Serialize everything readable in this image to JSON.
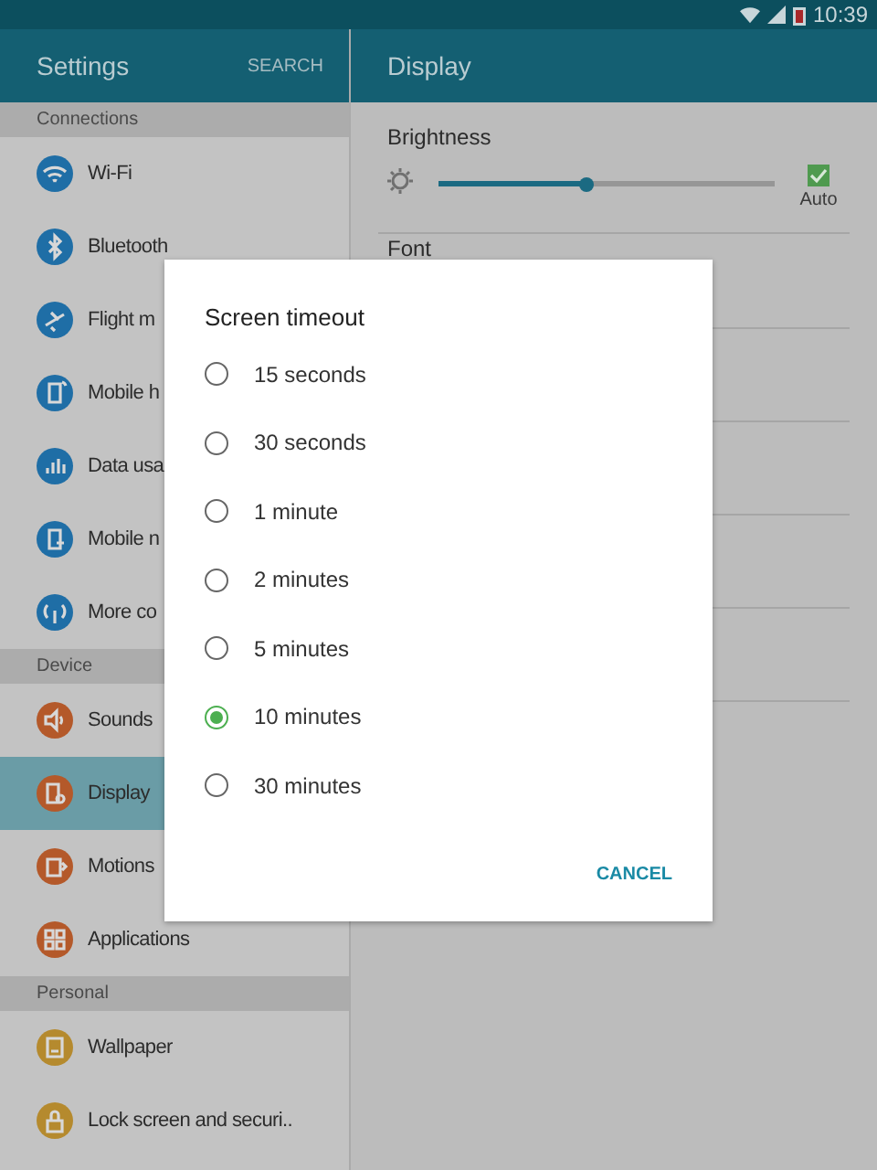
{
  "status_bar": {
    "time": "10:39"
  },
  "sidebar": {
    "title": "Settings",
    "search_button": "SEARCH",
    "sections": [
      {
        "header": "Connections",
        "items": [
          {
            "label": "Wi-Fi",
            "selected": false,
            "color": "#1f6ea6"
          },
          {
            "label": "Bluetooth",
            "selected": false,
            "color": "#1f6ea6"
          },
          {
            "label": "Flight m",
            "selected": false,
            "color": "#1f6ea6"
          },
          {
            "label": "Mobile h",
            "selected": false,
            "color": "#1f6ea6"
          },
          {
            "label": "Data usa",
            "selected": false,
            "color": "#1f6ea6"
          },
          {
            "label": "Mobile n",
            "selected": false,
            "color": "#1f6ea6"
          },
          {
            "label": "More co",
            "selected": false,
            "color": "#1f6ea6"
          }
        ]
      },
      {
        "header": "Device",
        "items": [
          {
            "label": "Sounds",
            "selected": false,
            "color": "#b4592a"
          },
          {
            "label": "Display",
            "selected": true,
            "color": "#b4592a"
          },
          {
            "label": "Motions",
            "selected": false,
            "color": "#b4592a"
          },
          {
            "label": "Applications",
            "selected": false,
            "color": "#b4592a"
          }
        ]
      },
      {
        "header": "Personal",
        "items": [
          {
            "label": "Wallpaper",
            "selected": false,
            "color": "#b58a2e"
          },
          {
            "label": "Lock screen and securi..",
            "selected": false,
            "color": "#b58a2e"
          }
        ]
      }
    ]
  },
  "detail": {
    "title": "Display",
    "brightness": {
      "label": "Brightness",
      "level": 0.44,
      "auto_label": "Auto",
      "auto_checked": true
    },
    "font_label": "Font"
  },
  "dialog": {
    "title": "Screen timeout",
    "options": [
      {
        "label": "15 seconds",
        "selected": false
      },
      {
        "label": "30 seconds",
        "selected": false
      },
      {
        "label": "1 minute",
        "selected": false
      },
      {
        "label": "2 minutes",
        "selected": false
      },
      {
        "label": "5 minutes",
        "selected": false
      },
      {
        "label": "10 minutes",
        "selected": true
      },
      {
        "label": "30 minutes",
        "selected": false
      }
    ],
    "cancel_button": "CANCEL"
  }
}
